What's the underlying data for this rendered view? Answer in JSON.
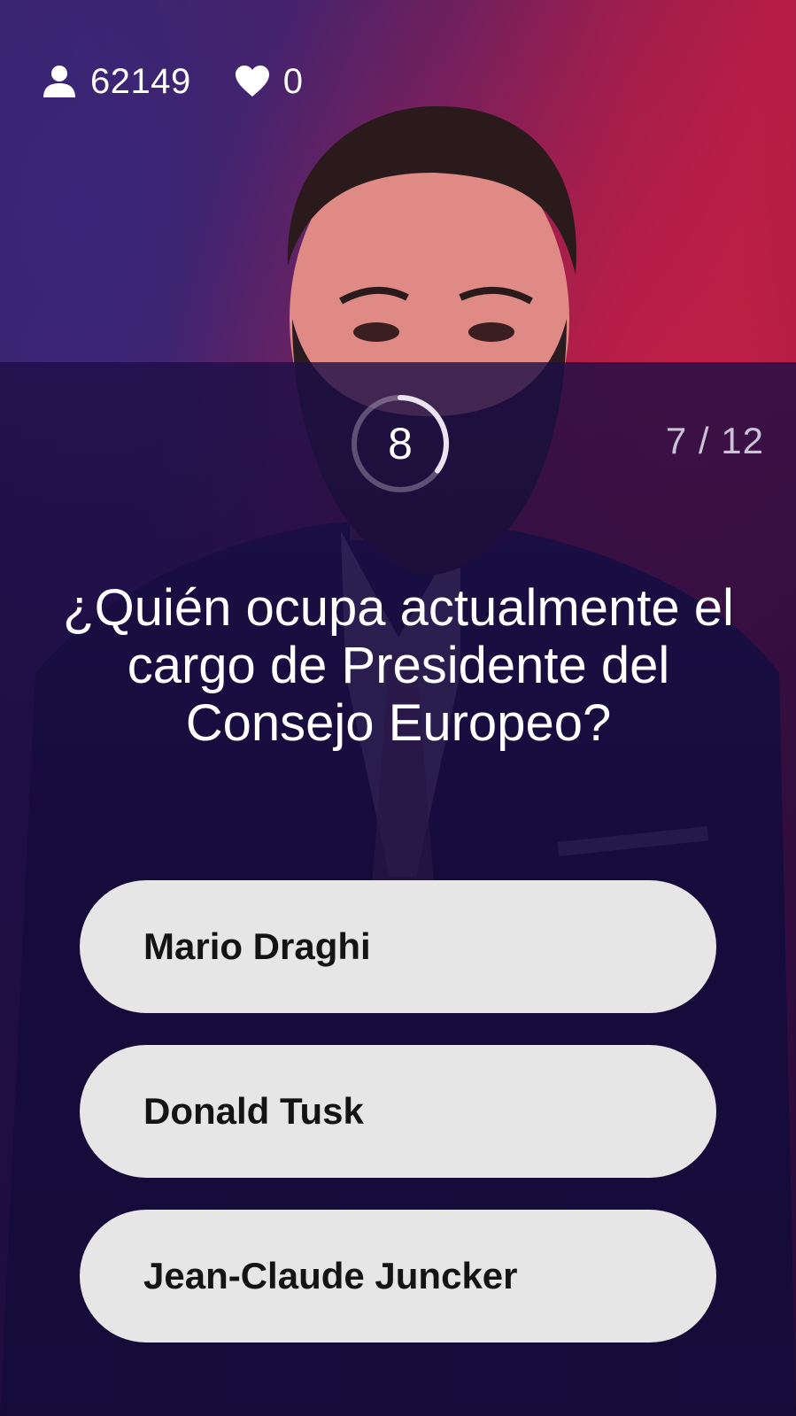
{
  "header": {
    "viewers_icon": "user-icon",
    "viewers_count": "62149",
    "likes_icon": "heart-icon",
    "likes_count": "0"
  },
  "round": {
    "timer_seconds": "8",
    "timer_fraction_remaining": 0.35,
    "progress": "7 / 12"
  },
  "question": {
    "text": "¿Quién ocupa actualmente el cargo de Presidente del Consejo Europeo?"
  },
  "answers": [
    {
      "label": "Mario Draghi"
    },
    {
      "label": "Donald Tusk"
    },
    {
      "label": "Jean-Claude Juncker"
    }
  ],
  "colors": {
    "background_accent": "#b21d45",
    "overlay": "#1c0f3e",
    "answer_bg": "#e6e6e6",
    "answer_text": "#141414",
    "progress_text": "#c9c3d6"
  }
}
